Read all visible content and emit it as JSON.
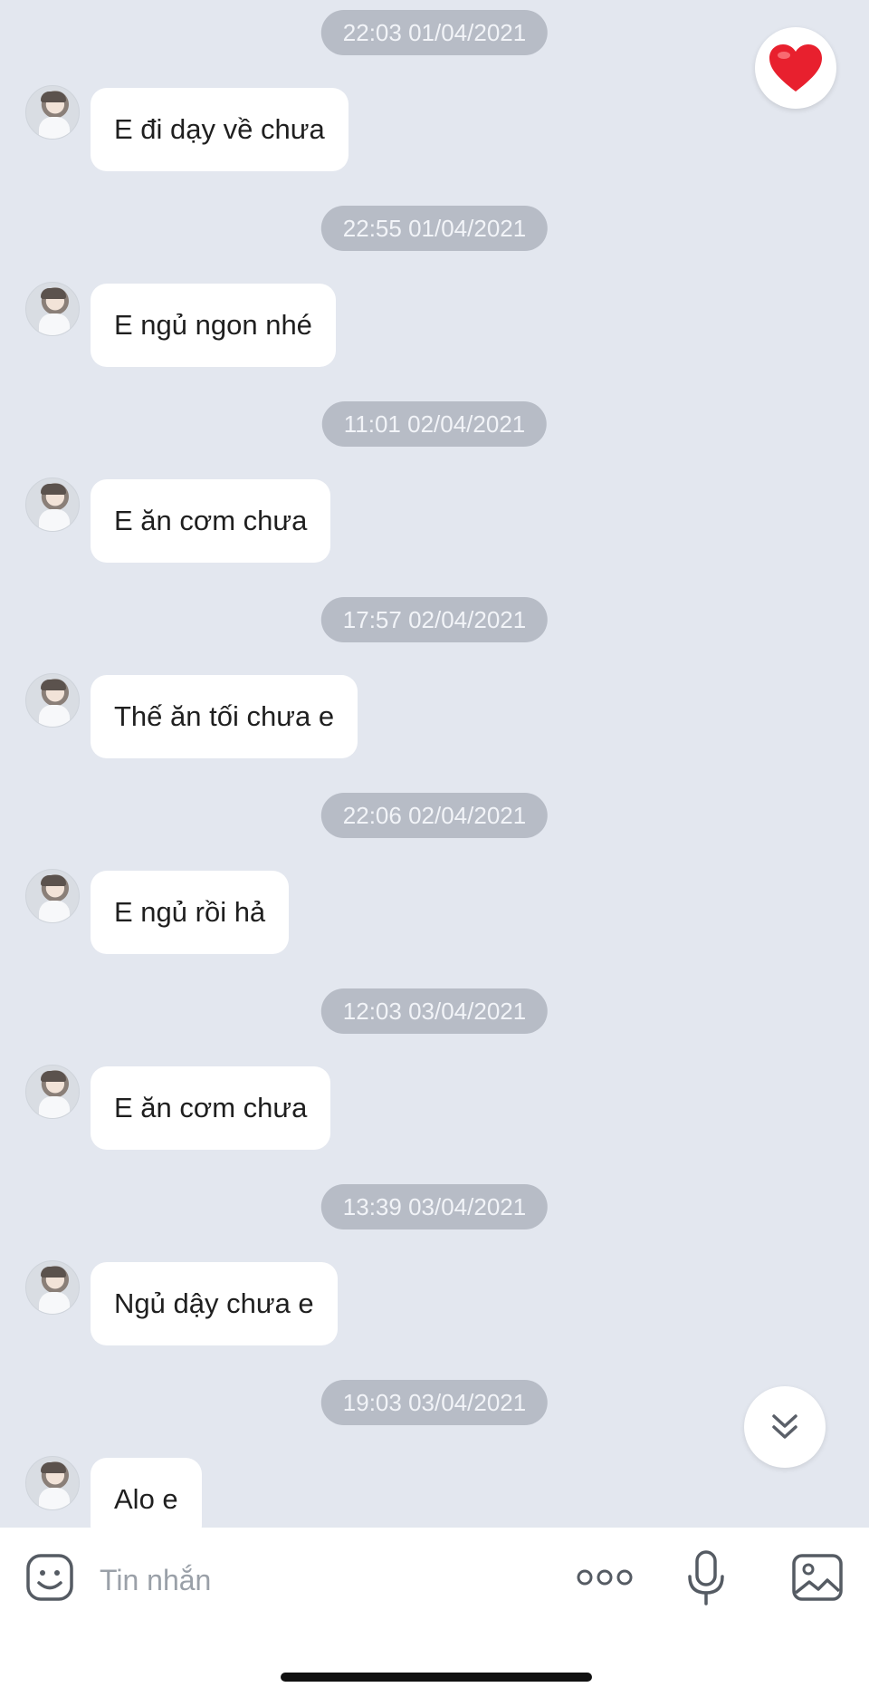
{
  "messages": [
    {
      "time": "22:03 01/04/2021",
      "text": "E đi dạy về chưa"
    },
    {
      "time": "22:55 01/04/2021",
      "text": "E ngủ ngon nhé"
    },
    {
      "time": "11:01 02/04/2021",
      "text": "E ăn cơm chưa"
    },
    {
      "time": "17:57 02/04/2021",
      "text": "Thế ăn tối chưa e"
    },
    {
      "time": "22:06 02/04/2021",
      "text": "E ngủ rồi hả"
    },
    {
      "time": "12:03 03/04/2021",
      "text": "E ăn cơm chưa"
    },
    {
      "time": "13:39 03/04/2021",
      "text": "Ngủ dậy chưa e"
    },
    {
      "time": "19:03 03/04/2021",
      "text": "Alo e"
    }
  ],
  "input": {
    "placeholder": "Tin nhắn"
  },
  "icons": {
    "reaction": "heart-icon",
    "scroll": "double-chevron-down-icon",
    "emoji": "emoji-icon",
    "more": "more-dots-icon",
    "mic": "microphone-icon",
    "gallery": "image-icon"
  },
  "colors": {
    "heart": "#e8202e",
    "background": "#e3e7ef",
    "timestamp_bg": "#b7bcc6"
  }
}
